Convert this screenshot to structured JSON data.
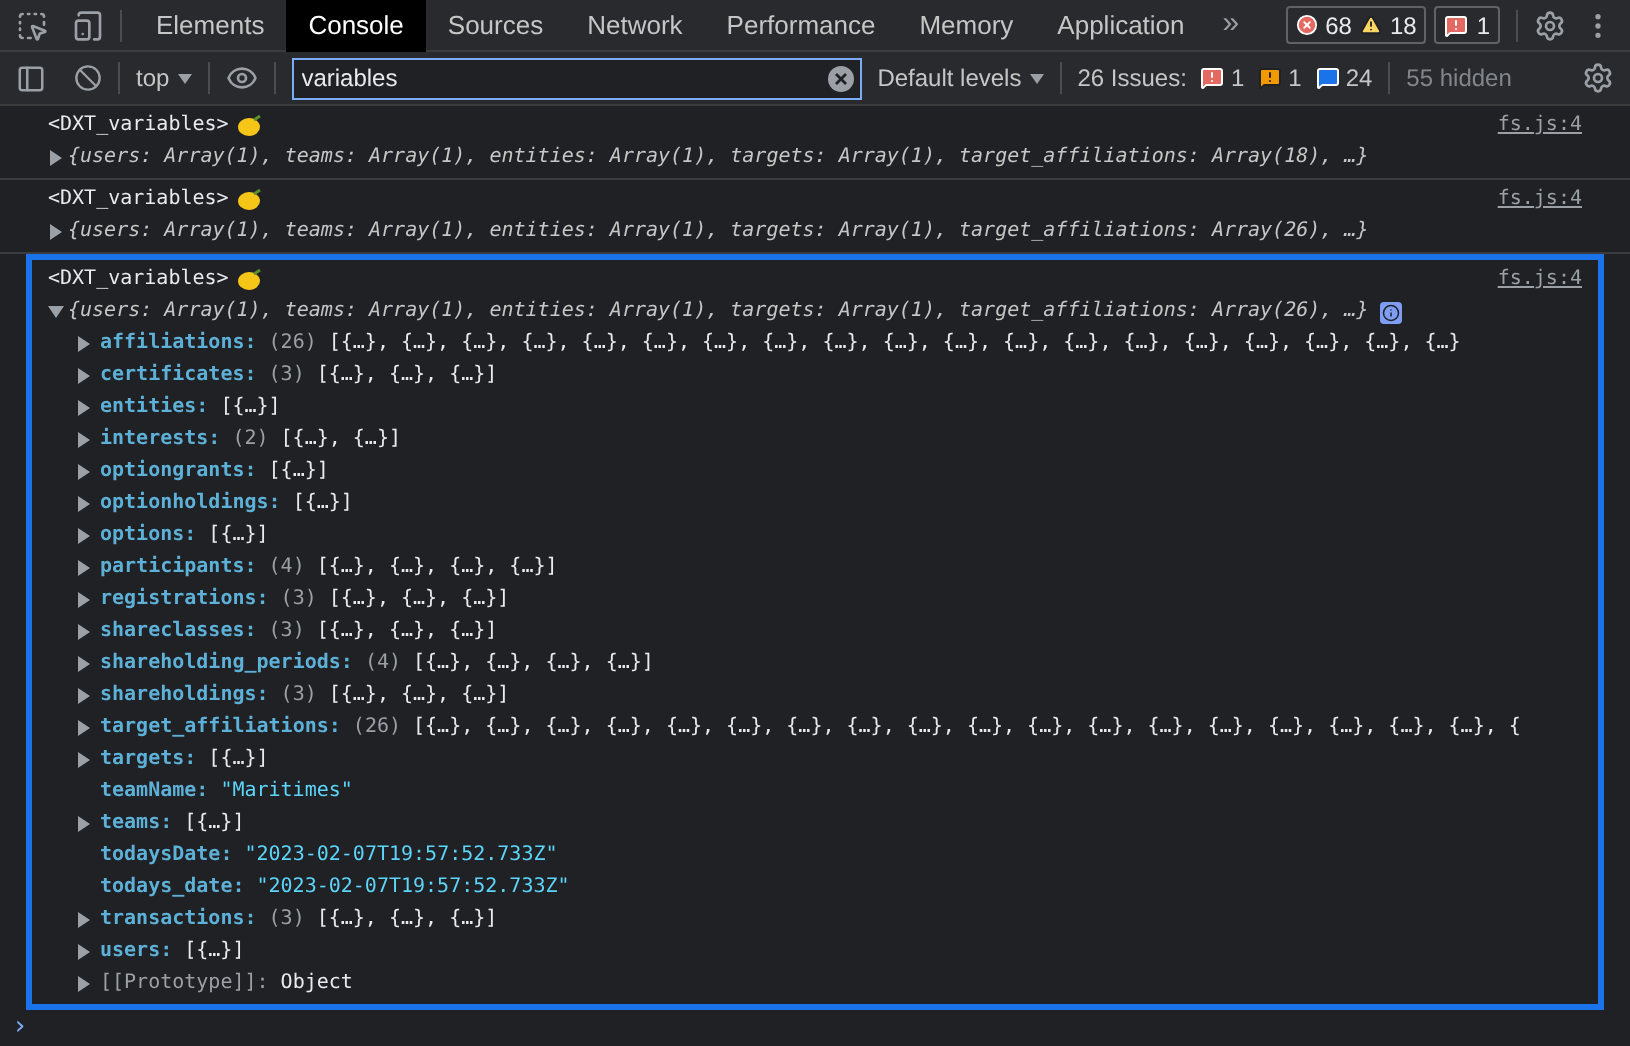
{
  "tabs": [
    {
      "label": "Elements",
      "selected": false
    },
    {
      "label": "Console",
      "selected": true
    },
    {
      "label": "Sources",
      "selected": false
    },
    {
      "label": "Network",
      "selected": false
    },
    {
      "label": "Performance",
      "selected": false
    },
    {
      "label": "Memory",
      "selected": false
    },
    {
      "label": "Application",
      "selected": false
    }
  ],
  "more_tabs": "»",
  "counters": {
    "errors": "68",
    "warnings": "18",
    "issues": "1"
  },
  "toolbar": {
    "context": "top",
    "filter": {
      "value": "variables"
    },
    "levels": "Default levels",
    "issues_label": "26 Issues:",
    "issue_counts": {
      "errors": "1",
      "warnings": "1",
      "info": "24"
    },
    "hidden": "55 hidden"
  },
  "messages": [
    {
      "label": "<DXT_variables>",
      "source": "fs.js:4",
      "expanded": false,
      "selected": false,
      "summary": "{users: Array(1), teams: Array(1), entities: Array(1), targets: Array(1), target_affiliations: Array(18), …}"
    },
    {
      "label": "<DXT_variables>",
      "source": "fs.js:4",
      "expanded": false,
      "selected": false,
      "summary": "{users: Array(1), teams: Array(1), entities: Array(1), targets: Array(1), target_affiliations: Array(26), …}"
    },
    {
      "label": "<DXT_variables>",
      "source": "fs.js:4",
      "expanded": true,
      "selected": true,
      "summary": "{users: Array(1), teams: Array(1), entities: Array(1), targets: Array(1), target_affiliations: Array(26), …}",
      "properties": [
        {
          "kind": "object",
          "name": "affiliations:",
          "count": "(26)",
          "value": "[{…}, {…}, {…}, {…}, {…}, {…}, {…}, {…}, {…}, {…}, {…}, {…}, {…}, {…}, {…}, {…}, {…}, {…}, {…}"
        },
        {
          "kind": "object",
          "name": "certificates:",
          "count": "(3)",
          "value": "[{…}, {…}, {…}]"
        },
        {
          "kind": "object",
          "name": "entities:",
          "value": "[{…}]"
        },
        {
          "kind": "object",
          "name": "interests:",
          "count": "(2)",
          "value": "[{…}, {…}]"
        },
        {
          "kind": "object",
          "name": "optiongrants:",
          "value": "[{…}]"
        },
        {
          "kind": "object",
          "name": "optionholdings:",
          "value": "[{…}]"
        },
        {
          "kind": "object",
          "name": "options:",
          "value": "[{…}]"
        },
        {
          "kind": "object",
          "name": "participants:",
          "count": "(4)",
          "value": "[{…}, {…}, {…}, {…}]"
        },
        {
          "kind": "object",
          "name": "registrations:",
          "count": "(3)",
          "value": "[{…}, {…}, {…}]"
        },
        {
          "kind": "object",
          "name": "shareclasses:",
          "count": "(3)",
          "value": "[{…}, {…}, {…}]"
        },
        {
          "kind": "object",
          "name": "shareholding_periods:",
          "count": "(4)",
          "value": "[{…}, {…}, {…}, {…}]"
        },
        {
          "kind": "object",
          "name": "shareholdings:",
          "count": "(3)",
          "value": "[{…}, {…}, {…}]"
        },
        {
          "kind": "object",
          "name": "target_affiliations:",
          "count": "(26)",
          "value": "[{…}, {…}, {…}, {…}, {…}, {…}, {…}, {…}, {…}, {…}, {…}, {…}, {…}, {…}, {…}, {…}, {…}, {…}, {"
        },
        {
          "kind": "object",
          "name": "targets:",
          "value": "[{…}]"
        },
        {
          "kind": "string",
          "name": "teamName:",
          "value": "\"Maritimes\""
        },
        {
          "kind": "object",
          "name": "teams:",
          "value": "[{…}]"
        },
        {
          "kind": "string",
          "name": "todaysDate:",
          "value": "\"2023-02-07T19:57:52.733Z\""
        },
        {
          "kind": "string",
          "name": "todays_date:",
          "value": "\"2023-02-07T19:57:52.733Z\""
        },
        {
          "kind": "object",
          "name": "transactions:",
          "count": "(3)",
          "value": "[{…}, {…}, {…}]"
        },
        {
          "kind": "object",
          "name": "users:",
          "value": "[{…}]"
        },
        {
          "kind": "prototype",
          "name": "[[Prototype]]:",
          "value": "Object"
        }
      ]
    }
  ],
  "prompt": "›"
}
